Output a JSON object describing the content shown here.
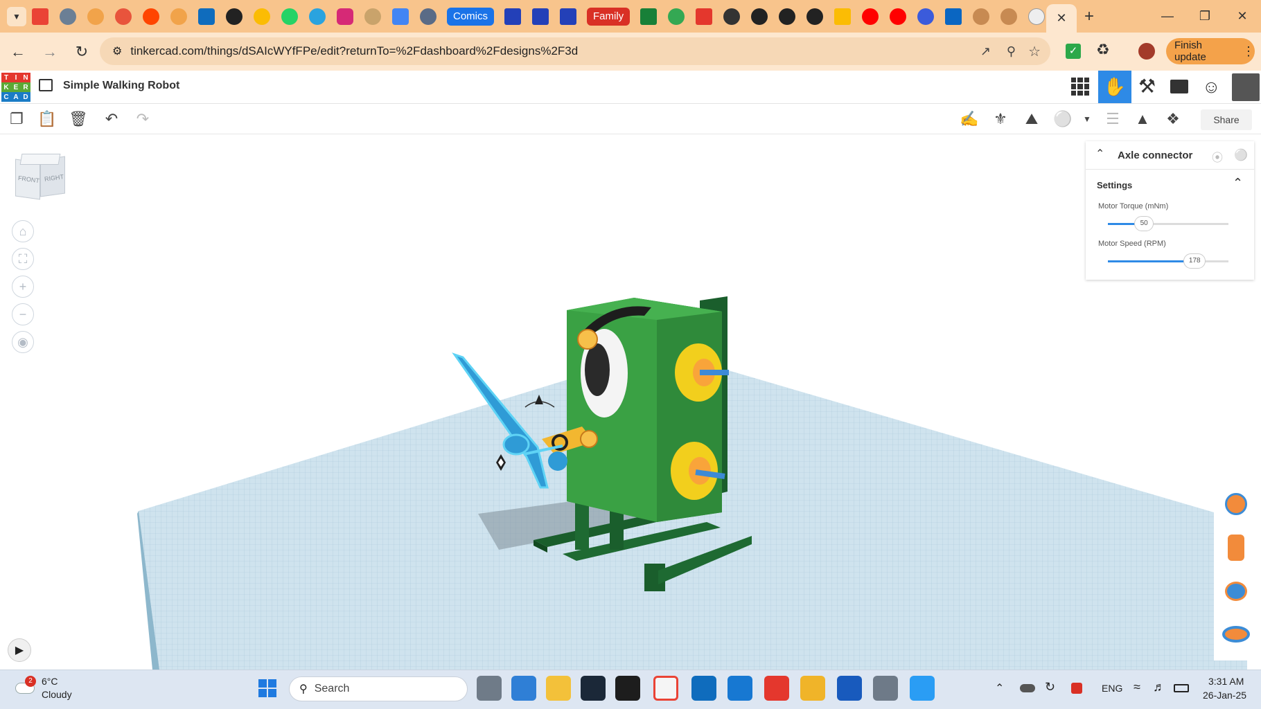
{
  "browser": {
    "tabs_pills": [
      {
        "label": "Comics",
        "color": "#1a73e8"
      },
      {
        "label": "Family",
        "color": "#d93025"
      }
    ],
    "active_tab_close": "✕",
    "new_tab": "+",
    "url": "tinkercad.com/things/dSAIcWYfFPe/edit?returnTo=%2Fdashboard%2Fdesigns%2F3d",
    "finish_update": "Finish update"
  },
  "app": {
    "logo_letters": [
      "T",
      "I",
      "N",
      "K",
      "E",
      "R",
      "C",
      "A",
      "D"
    ],
    "logo_colors": [
      "#e4372d",
      "#e4372d",
      "#e4372d",
      "#5ba935",
      "#5ba935",
      "#5ba935",
      "#1a7cc6",
      "#1a7cc6",
      "#1a7cc6"
    ],
    "design_title": "Simple Walking Robot",
    "share_label": "Share"
  },
  "viewcube": {
    "front": "FRONT",
    "right": "RIGHT"
  },
  "inspector": {
    "title": "Axle connector",
    "section": "Settings",
    "torque": {
      "label": "Motor Torque (mNm)",
      "value": 50,
      "fraction": 0.3
    },
    "speed": {
      "label": "Motor Speed (RPM)",
      "value": 178,
      "fraction": 0.72
    }
  },
  "taskbar": {
    "weather_temp": "6°C",
    "weather_desc": "Cloudy",
    "weather_badge": "2",
    "search_placeholder": "Search",
    "lang": "ENG",
    "time": "3:31 AM",
    "date": "26-Jan-25"
  }
}
